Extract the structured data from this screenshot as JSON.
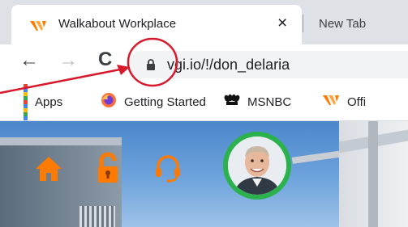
{
  "browser": {
    "tabs": [
      {
        "title": "Walkabout Workplace",
        "close_label": "×",
        "favicon": "walkabout-logo-icon"
      },
      {
        "title": "New Tab"
      }
    ],
    "toolbar": {
      "back_glyph": "←",
      "forward_glyph": "→",
      "reload_glyph": "C",
      "url": "vgi.io/!/don_delaria"
    },
    "bookmarks": [
      {
        "label": "Apps",
        "icon": "apps-grid-icon"
      },
      {
        "label": "Getting Started",
        "icon": "firefox-icon"
      },
      {
        "label": "MSNBC",
        "icon": "msnbc-peacock-icon"
      },
      {
        "label": "Offi",
        "icon": "walkabout-logo-icon"
      }
    ]
  },
  "page": {
    "icons": [
      "home-icon",
      "lock-icon",
      "headset-icon"
    ],
    "accent_color": "#ff7a00",
    "avatar_ring_color": "#2bb24c"
  },
  "annotation": {
    "color": "#d8192b",
    "target": "lock-icon"
  }
}
